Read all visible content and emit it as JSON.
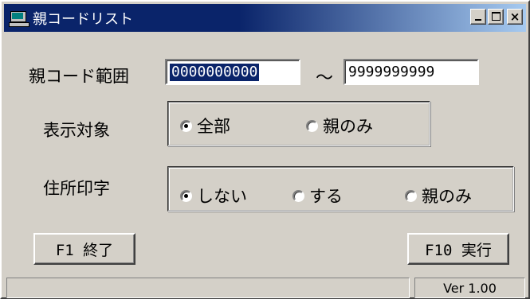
{
  "window": {
    "title": "親コードリスト",
    "icon": "computer-icon",
    "controls": {
      "minimize": "minimize-icon",
      "maximize": "maximize-icon",
      "close": "×"
    }
  },
  "range": {
    "label": "親コード範囲",
    "from_value": "0000000000",
    "separator": "～",
    "to_value": "9999999999"
  },
  "display_target": {
    "label": "表示対象",
    "options": [
      "全部",
      "親のみ"
    ],
    "selected": "全部"
  },
  "address_print": {
    "label": "住所印字",
    "options": [
      "しない",
      "する",
      "親のみ"
    ],
    "selected": "しない"
  },
  "buttons": {
    "exit": "F1 終了",
    "run": "F10 実行"
  },
  "status": {
    "message": "",
    "version": "Ver 1.00"
  }
}
